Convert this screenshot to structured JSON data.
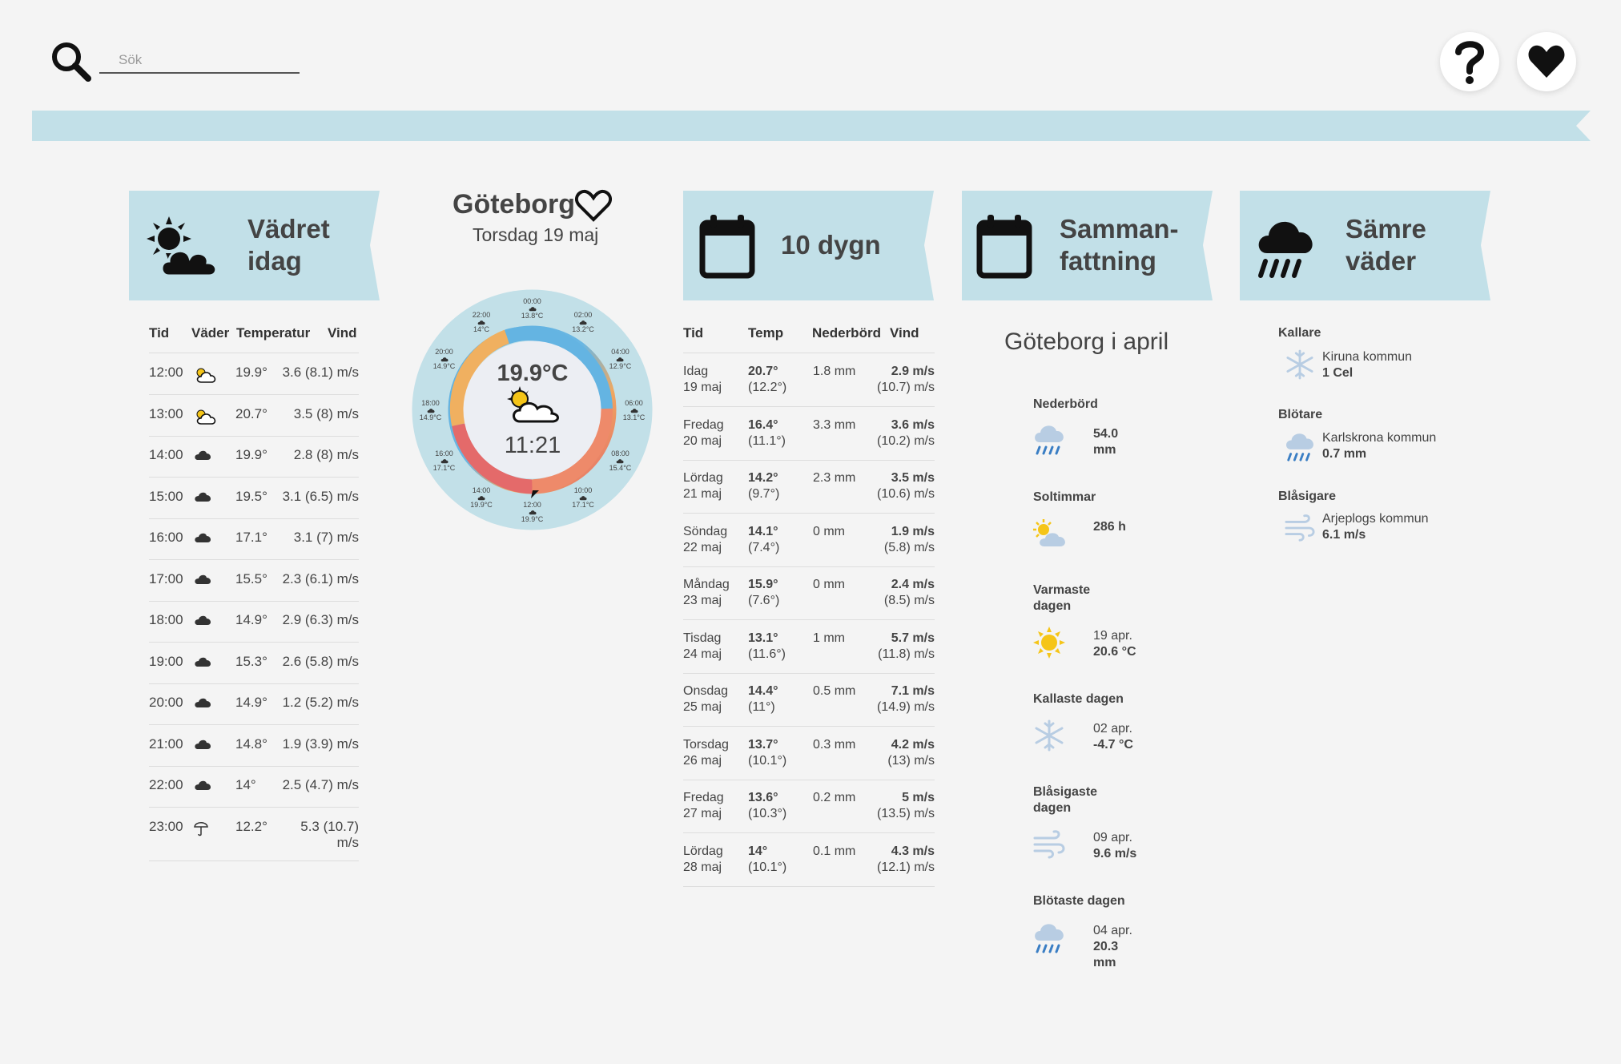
{
  "search": {
    "placeholder": "Sök"
  },
  "today": {
    "title_line1": "Vädret",
    "title_line2": "idag",
    "headers": {
      "time": "Tid",
      "weather": "Väder",
      "temp": "Temperatur",
      "wind": "Vind"
    },
    "rows": [
      {
        "time": "12:00",
        "icon": "partly-sunny-icon",
        "temp": "19.9°",
        "wind": "3.6 (8.1) m/s"
      },
      {
        "time": "13:00",
        "icon": "partly-sunny-icon",
        "temp": "20.7°",
        "wind": "3.5 (8) m/s"
      },
      {
        "time": "14:00",
        "icon": "cloud-icon",
        "temp": "19.9°",
        "wind": "2.8 (8) m/s"
      },
      {
        "time": "15:00",
        "icon": "cloud-icon",
        "temp": "19.5°",
        "wind": "3.1 (6.5) m/s"
      },
      {
        "time": "16:00",
        "icon": "cloud-icon",
        "temp": "17.1°",
        "wind": "3.1 (7) m/s"
      },
      {
        "time": "17:00",
        "icon": "cloud-icon",
        "temp": "15.5°",
        "wind": "2.3 (6.1) m/s"
      },
      {
        "time": "18:00",
        "icon": "cloud-icon",
        "temp": "14.9°",
        "wind": "2.9 (6.3) m/s"
      },
      {
        "time": "19:00",
        "icon": "cloud-icon",
        "temp": "15.3°",
        "wind": "2.6 (5.8) m/s"
      },
      {
        "time": "20:00",
        "icon": "cloud-icon",
        "temp": "14.9°",
        "wind": "1.2 (5.2) m/s"
      },
      {
        "time": "21:00",
        "icon": "cloud-icon",
        "temp": "14.8°",
        "wind": "1.9 (3.9) m/s"
      },
      {
        "time": "22:00",
        "icon": "cloud-icon",
        "temp": "14°",
        "wind": "2.5 (4.7) m/s"
      },
      {
        "time": "23:00",
        "icon": "umbrella-icon",
        "temp": "12.2°",
        "wind_line1": "5.3 (10.7)",
        "wind_line2": "m/s"
      }
    ]
  },
  "clock": {
    "city": "Göteborg",
    "date": "Torsdag 19 maj",
    "current_temp": "19.9°C",
    "current_time": "11:21",
    "hours": [
      {
        "time": "00:00",
        "temp": "13.8°C"
      },
      {
        "time": "02:00",
        "temp": "13.2°C"
      },
      {
        "time": "04:00",
        "temp": "12.9°C"
      },
      {
        "time": "06:00",
        "temp": "13.1°C"
      },
      {
        "time": "08:00",
        "temp": "15.4°C"
      },
      {
        "time": "10:00",
        "temp": "17.1°C"
      },
      {
        "time": "12:00",
        "temp": "19.9°C"
      },
      {
        "time": "14:00",
        "temp": "19.9°C"
      },
      {
        "time": "16:00",
        "temp": "17.1°C"
      },
      {
        "time": "18:00",
        "temp": "14.9°C"
      },
      {
        "time": "20:00",
        "temp": "14.9°C"
      },
      {
        "time": "22:00",
        "temp": "14°C"
      }
    ]
  },
  "ten_days": {
    "title": "10 dygn",
    "headers": {
      "time": "Tid",
      "temp": "Temp",
      "precip": "Nederbörd",
      "wind": "Vind"
    },
    "rows": [
      {
        "day": "Idag",
        "date": "19 maj",
        "temp": "20.7°",
        "temp_min": "(12.2°)",
        "precip": "1.8 mm",
        "wind": "2.9 m/s",
        "gust": "(10.7) m/s"
      },
      {
        "day": "Fredag",
        "date": "20 maj",
        "temp": "16.4°",
        "temp_min": "(11.1°)",
        "precip": "3.3 mm",
        "wind": "3.6 m/s",
        "gust": "(10.2) m/s"
      },
      {
        "day": "Lördag",
        "date": "21 maj",
        "temp": "14.2°",
        "temp_min": "(9.7°)",
        "precip": "2.3 mm",
        "wind": "3.5 m/s",
        "gust": "(10.6) m/s"
      },
      {
        "day": "Söndag",
        "date": "22 maj",
        "temp": "14.1°",
        "temp_min": "(7.4°)",
        "precip": "0 mm",
        "wind": "1.9 m/s",
        "gust": "(5.8) m/s"
      },
      {
        "day": "Måndag",
        "date": "23 maj",
        "temp": "15.9°",
        "temp_min": "(7.6°)",
        "precip": "0 mm",
        "wind": "2.4 m/s",
        "gust": "(8.5) m/s"
      },
      {
        "day": "Tisdag",
        "date": "24 maj",
        "temp": "13.1°",
        "temp_min": "(11.6°)",
        "precip": "1 mm",
        "wind": "5.7 m/s",
        "gust": "(11.8) m/s"
      },
      {
        "day": "Onsdag",
        "date": "25 maj",
        "temp": "14.4°",
        "temp_min": "(11°)",
        "precip": "0.5 mm",
        "wind": "7.1 m/s",
        "gust": "(14.9) m/s"
      },
      {
        "day": "Torsdag",
        "date": "26 maj",
        "temp": "13.7°",
        "temp_min": "(10.1°)",
        "precip": "0.3 mm",
        "wind": "4.2 m/s",
        "gust": "(13) m/s"
      },
      {
        "day": "Fredag",
        "date": "27 maj",
        "temp": "13.6°",
        "temp_min": "(10.3°)",
        "precip": "0.2 mm",
        "wind": "5 m/s",
        "gust": "(13.5) m/s"
      },
      {
        "day": "Lördag",
        "date": "28 maj",
        "temp": "14°",
        "temp_min": "(10.1°)",
        "precip": "0.1 mm",
        "wind": "4.3 m/s",
        "gust": "(12.1) m/s"
      }
    ]
  },
  "summary": {
    "title_line1": "Samman-",
    "title_line2": "fattning",
    "heading": "Göteborg i april",
    "precip_label": "Nederbörd",
    "precip_value": "54.0",
    "precip_unit": "mm",
    "sun_label": "Soltimmar",
    "sun_value": "286 h",
    "warmest_label1": "Varmaste",
    "warmest_label2": "dagen",
    "warmest_date": "19 apr.",
    "warmest_value": "20.6 °C",
    "coldest_label": "Kallaste dagen",
    "coldest_date": "02 apr.",
    "coldest_value": "-4.7 °C",
    "windiest_label1": "Blåsigaste",
    "windiest_label2": "dagen",
    "windiest_date": "09 apr.",
    "windiest_value": "9.6 m/s",
    "wettest_label": "Blötaste dagen",
    "wettest_date": "04 apr.",
    "wettest_value": "20.3",
    "wettest_unit": "mm"
  },
  "worse": {
    "title_line1": "Sämre",
    "title_line2": "väder",
    "colder_label": "Kallare",
    "colder_place": "Kiruna kommun",
    "colder_value": "1 Cel",
    "wetter_label": "Blötare",
    "wetter_place": "Karlskrona kommun",
    "wetter_value": "0.7 mm",
    "windier_label": "Blåsigare",
    "windier_place": "Arjeplogs kommun",
    "windier_value": "6.1 m/s"
  },
  "colors": {
    "accent": "#c2e0e8",
    "text": "#333333",
    "sun": "#f5c518",
    "rain": "#3a7ec4"
  }
}
